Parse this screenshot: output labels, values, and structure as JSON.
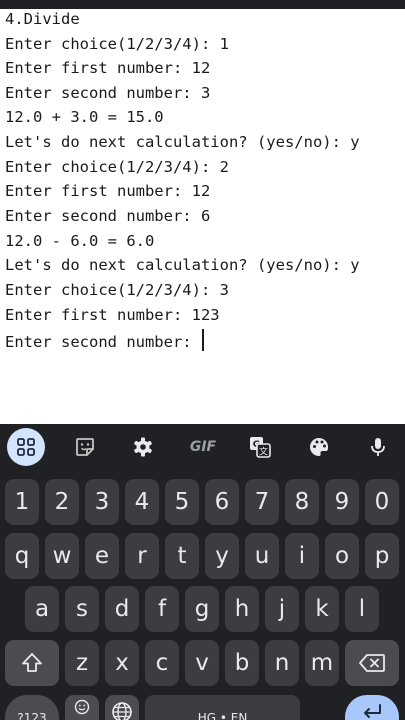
{
  "terminal": {
    "lines": [
      "4.Divide",
      "Enter choice(1/2/3/4): 1",
      "Enter first number: 12",
      "Enter second number: 3",
      "12.0 + 3.0 = 15.0",
      "Let's do next calculation? (yes/no): y",
      "Enter choice(1/2/3/4): 2",
      "Enter first number: 12",
      "Enter second number: 6",
      "12.0 - 6.0 = 6.0",
      "Let's do next calculation? (yes/no): y",
      "Enter choice(1/2/3/4): 3",
      "Enter first number: 123",
      "Enter second number: "
    ]
  },
  "keyboard": {
    "toolbar": {
      "items": [
        {
          "icon": "apps-grid-icon"
        },
        {
          "icon": "sticker-icon"
        },
        {
          "icon": "settings-gear-icon"
        },
        {
          "icon": "gif-icon",
          "label": "GIF"
        },
        {
          "icon": "translate-icon"
        },
        {
          "icon": "palette-icon"
        },
        {
          "icon": "microphone-icon"
        }
      ]
    },
    "rows": {
      "numbers": [
        "1",
        "2",
        "3",
        "4",
        "5",
        "6",
        "7",
        "8",
        "9",
        "0"
      ],
      "row1": [
        "q",
        "w",
        "e",
        "r",
        "t",
        "y",
        "u",
        "i",
        "o",
        "p"
      ],
      "row2": [
        "a",
        "s",
        "d",
        "f",
        "g",
        "h",
        "j",
        "k",
        "l"
      ],
      "row3": [
        "z",
        "x",
        "c",
        "v",
        "b",
        "n",
        "m"
      ]
    },
    "bottom": {
      "symbols_label": "?123",
      "space_label": "HG • EN"
    }
  },
  "colors": {
    "keyboard_bg": "#202124",
    "key_bg": "#3c3d41",
    "key_text": "#e8eaed",
    "accent": "#a8c7fa"
  }
}
